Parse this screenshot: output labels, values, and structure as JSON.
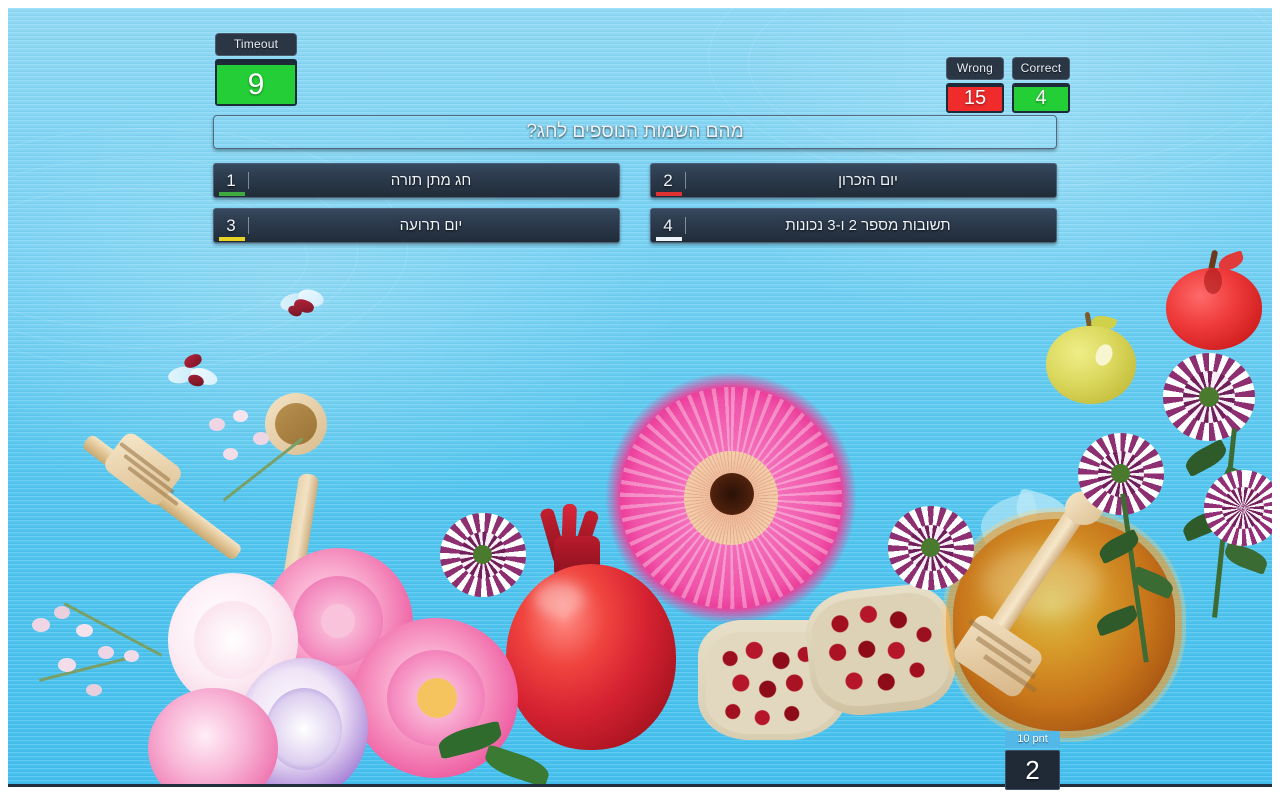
{
  "hud": {
    "timeout": {
      "label": "Timeout",
      "value": "9",
      "color": "#24ce36"
    },
    "wrong": {
      "label": "Wrong",
      "value": "15",
      "color": "#ef2b2b"
    },
    "correct": {
      "label": "Correct",
      "value": "4",
      "color": "#24ce36"
    },
    "points": {
      "label": "10 pnt",
      "value": "2",
      "color": "#53b7e8"
    }
  },
  "quiz": {
    "question": "מהם השמות הנוספים לחג?",
    "answers": [
      {
        "number": "1",
        "text": "חג מתן תורה",
        "marker_color": "#3faa3f"
      },
      {
        "number": "2",
        "text": "יום הזכרון",
        "marker_color": "#e03232"
      },
      {
        "number": "3",
        "text": "יום תרועה",
        "marker_color": "#e8d327"
      },
      {
        "number": "4",
        "text": "תשובות מספר 2 ו-3 נכונות",
        "marker_color": "#eef3f9"
      }
    ]
  },
  "theme": {
    "panel_dark": "#2c3b4d",
    "panel_border": "#4e6179",
    "text_light": "#eef3f9",
    "board_blue": "#53c6ef",
    "frame_white": "#ffffff"
  }
}
